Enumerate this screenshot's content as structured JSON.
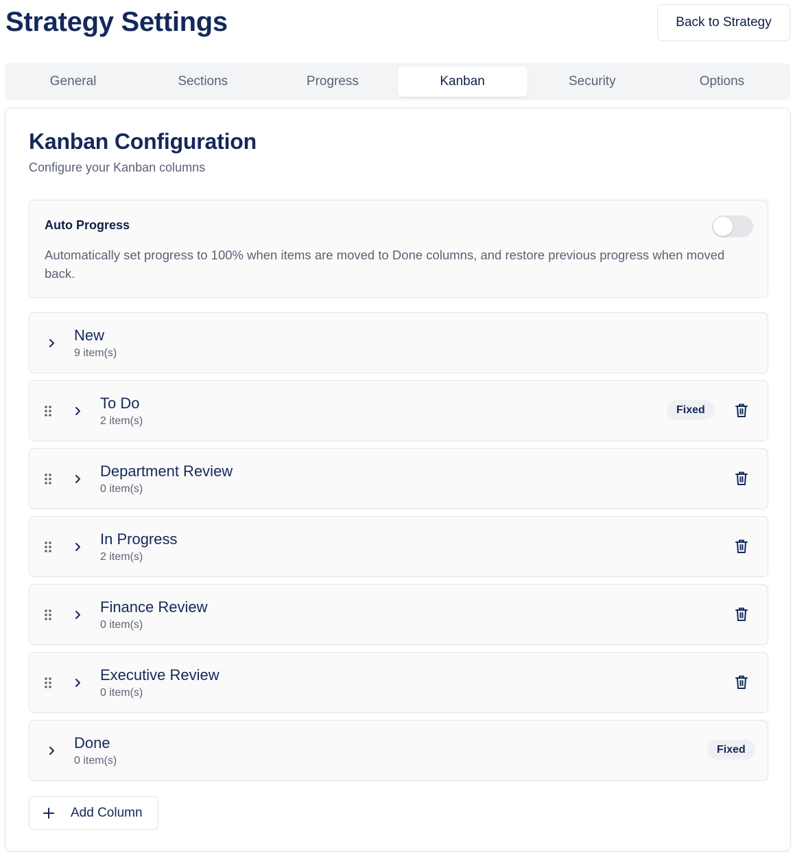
{
  "header": {
    "title": "Strategy Settings",
    "back_label": "Back to Strategy"
  },
  "tabs": [
    {
      "label": "General",
      "active": false
    },
    {
      "label": "Sections",
      "active": false
    },
    {
      "label": "Progress",
      "active": false
    },
    {
      "label": "Kanban",
      "active": true
    },
    {
      "label": "Security",
      "active": false
    },
    {
      "label": "Options",
      "active": false
    }
  ],
  "kanban": {
    "title": "Kanban Configuration",
    "subtitle": "Configure your Kanban columns",
    "auto_progress": {
      "label": "Auto Progress",
      "description": "Automatically set progress to 100% when items are moved to Done columns, and restore previous progress when moved back.",
      "enabled": false
    },
    "columns": [
      {
        "name": "New",
        "count": "9 item(s)",
        "draggable": false,
        "badge": "",
        "deletable": false
      },
      {
        "name": "To Do",
        "count": "2 item(s)",
        "draggable": true,
        "badge": "Fixed",
        "deletable": true
      },
      {
        "name": "Department Review",
        "count": "0 item(s)",
        "draggable": true,
        "badge": "",
        "deletable": true
      },
      {
        "name": "In Progress",
        "count": "2 item(s)",
        "draggable": true,
        "badge": "",
        "deletable": true
      },
      {
        "name": "Finance Review",
        "count": "0 item(s)",
        "draggable": true,
        "badge": "",
        "deletable": true
      },
      {
        "name": "Executive Review",
        "count": "0 item(s)",
        "draggable": true,
        "badge": "",
        "deletable": true
      },
      {
        "name": "Done",
        "count": "0 item(s)",
        "draggable": false,
        "badge": "Fixed",
        "deletable": false
      }
    ],
    "add_label": "Add Column"
  },
  "icons": {
    "drag": "drag-handle-icon",
    "expand": "chevron-right-icon",
    "delete": "trash-icon",
    "add": "plus-icon"
  },
  "colors": {
    "primary_text": "#14285a",
    "muted_text": "#5b6275",
    "row_background": "#fafafa",
    "border": "#e1e4ea"
  }
}
